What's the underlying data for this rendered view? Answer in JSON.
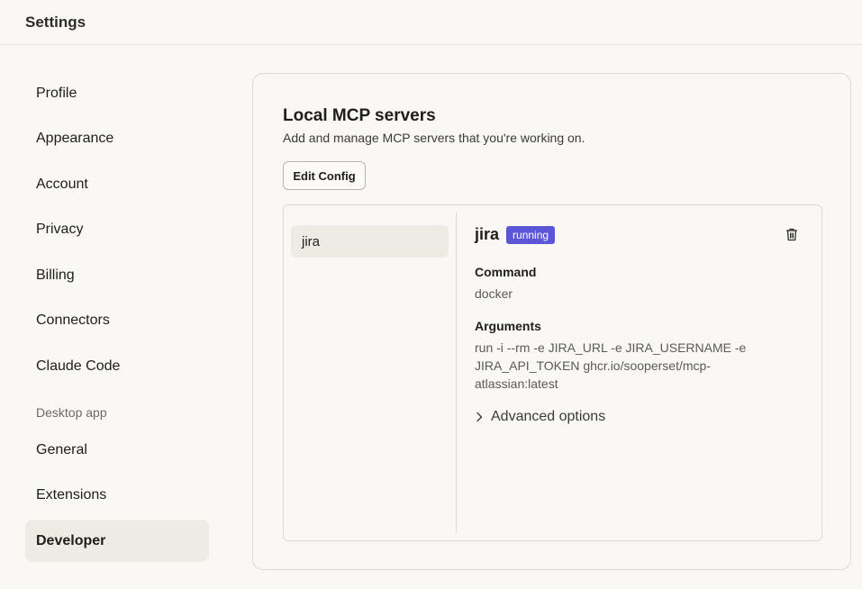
{
  "header": {
    "title": "Settings"
  },
  "sidebar": {
    "items": [
      {
        "label": "Profile"
      },
      {
        "label": "Appearance"
      },
      {
        "label": "Account"
      },
      {
        "label": "Privacy"
      },
      {
        "label": "Billing"
      },
      {
        "label": "Connectors"
      },
      {
        "label": "Claude Code"
      }
    ],
    "section_label": "Desktop app",
    "desktop_items": [
      {
        "label": "General"
      },
      {
        "label": "Extensions"
      },
      {
        "label": "Developer"
      }
    ],
    "active": "Developer"
  },
  "main": {
    "title": "Local MCP servers",
    "subtitle": "Add and manage MCP servers that you're working on.",
    "edit_config_label": "Edit Config",
    "servers": [
      {
        "name": "jira"
      }
    ],
    "selected": {
      "name": "jira",
      "status": "running",
      "status_color": "#5b55d8",
      "command_label": "Command",
      "command": "docker",
      "arguments_label": "Arguments",
      "arguments_lines": [
        "run -i --rm -e JIRA_URL -e JIRA_USERNAME -e",
        "JIRA_API_TOKEN ghcr.io/sooperset/mcp-",
        "atlassian:latest"
      ],
      "advanced_label": "Advanced options",
      "delete_icon": "trash-icon"
    }
  }
}
